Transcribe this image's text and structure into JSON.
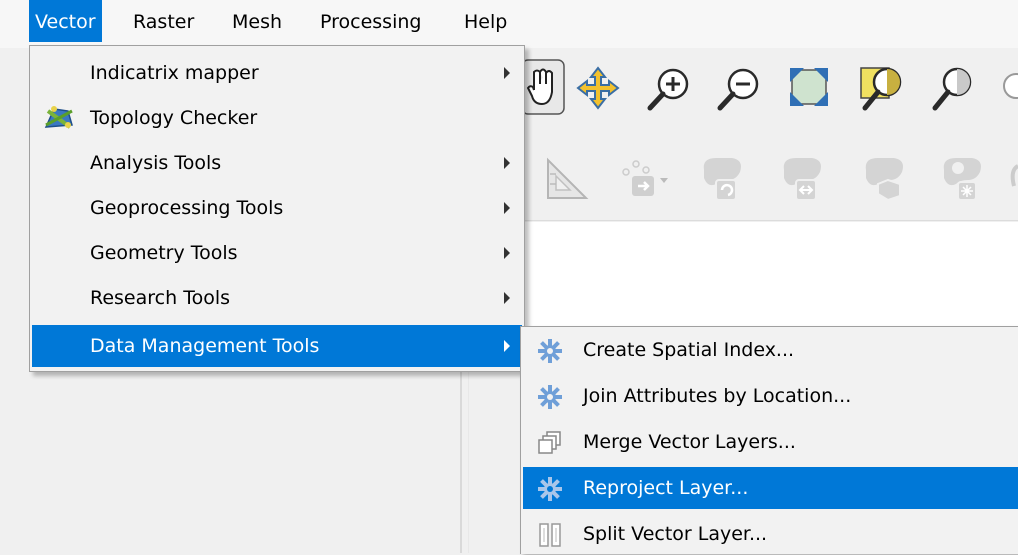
{
  "menubar": {
    "items": [
      {
        "label": "Vector",
        "active": true
      },
      {
        "label": "Raster"
      },
      {
        "label": "Mesh"
      },
      {
        "label": "Processing"
      },
      {
        "label": "Help"
      }
    ]
  },
  "vector_menu": {
    "items": [
      {
        "label": "Indicatrix mapper",
        "has_submenu": true
      },
      {
        "label": "Topology Checker",
        "icon": "topology-checker-icon"
      },
      {
        "label": "Analysis Tools",
        "has_submenu": true
      },
      {
        "label": "Geoprocessing Tools",
        "has_submenu": true
      },
      {
        "label": "Geometry Tools",
        "has_submenu": true
      },
      {
        "label": "Research Tools",
        "has_submenu": true
      },
      {
        "label": "Data Management Tools",
        "has_submenu": true,
        "active": true
      }
    ]
  },
  "data_management_submenu": {
    "items": [
      {
        "label": "Create Spatial Index...",
        "icon": "gear-icon"
      },
      {
        "label": "Join Attributes by Location...",
        "icon": "gear-icon"
      },
      {
        "label": "Merge Vector Layers...",
        "icon": "merge-layers-icon"
      },
      {
        "label": "Reproject Layer...",
        "icon": "gear-icon",
        "active": true
      },
      {
        "label": "Split Vector Layer...",
        "icon": "split-layer-icon"
      }
    ]
  },
  "colors": {
    "highlight": "#0078d7",
    "menu_background": "#f2f2f2"
  }
}
